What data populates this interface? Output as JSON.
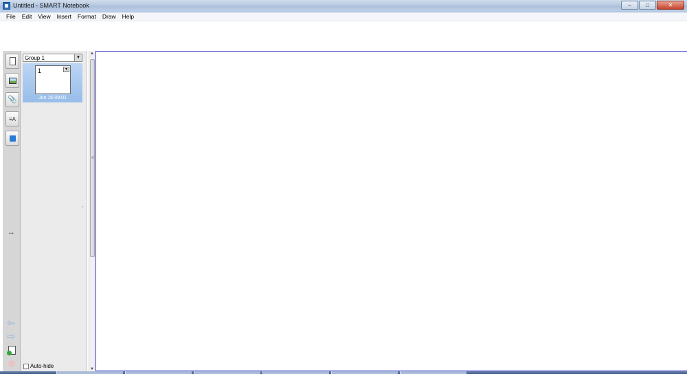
{
  "window": {
    "title": "Untitled - SMART Notebook",
    "controls": {
      "minimize": "–",
      "maximize": "□",
      "close": "✕"
    }
  },
  "menubar": {
    "items": [
      "File",
      "Edit",
      "View",
      "Insert",
      "Format",
      "Draw",
      "Help"
    ]
  },
  "sidebar": {
    "tools": [
      {
        "name": "page-sorter",
        "icon": "page-icon"
      },
      {
        "name": "gallery",
        "icon": "gallery-image-icon"
      },
      {
        "name": "attachments",
        "icon": "paperclip-icon"
      },
      {
        "name": "properties",
        "icon": "properties-icon"
      },
      {
        "name": "add-ons",
        "icon": "puzzle-icon"
      }
    ],
    "swap_icon": "↔",
    "nav_back": "⇦",
    "nav_forward": "⇨"
  },
  "sorter": {
    "group": "Group 1",
    "pages": [
      {
        "number": "1",
        "date": "Jun 15-09:01"
      }
    ],
    "autohide_label": "Auto-hide",
    "autohide_checked": false
  },
  "colors": {
    "canvas_border": "#3c3ccf",
    "thumb_highlight": "#a9c8ef"
  }
}
